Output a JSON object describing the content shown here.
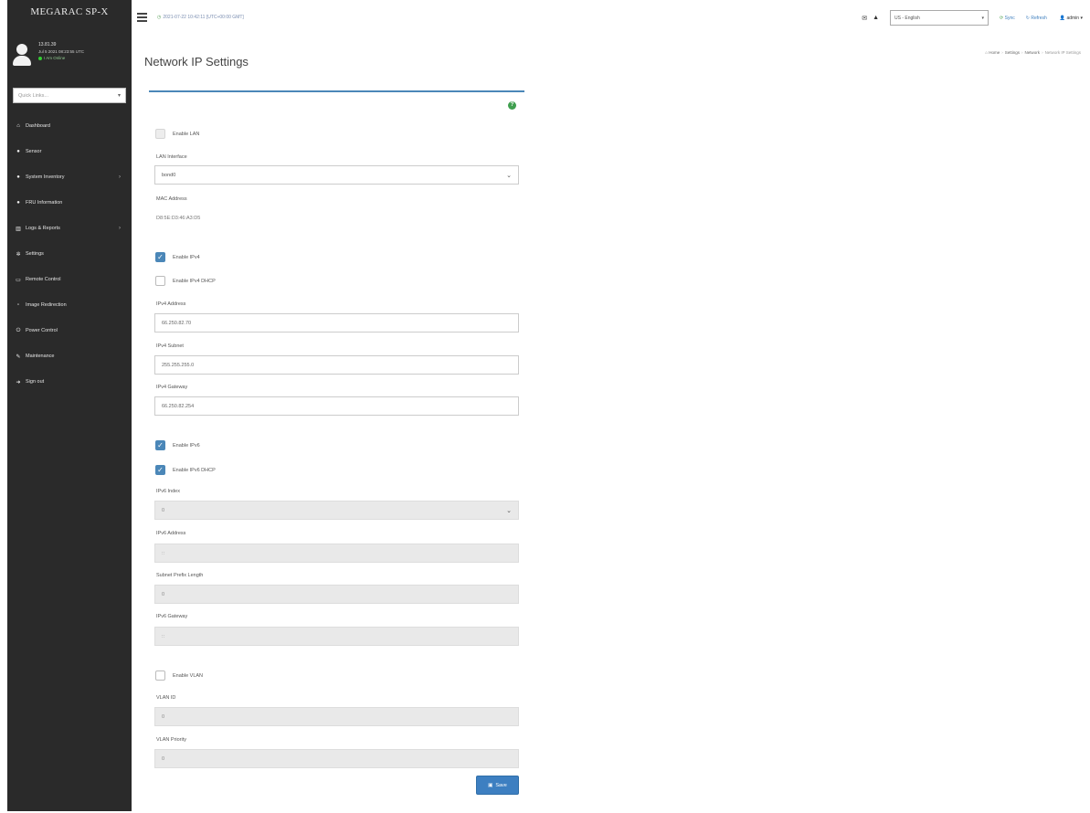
{
  "app": {
    "brand": "MEGARAC SP-X"
  },
  "user": {
    "name": "13.81.39",
    "session": "Jul 5 2021 08:23:55 UTC",
    "status": "I Am Online"
  },
  "sidebar": {
    "quicklinks_placeholder": "Quick Links...",
    "items": [
      {
        "label": "Dashboard",
        "icon": "home-icon"
      },
      {
        "label": "Sensor",
        "icon": "sensor-icon"
      },
      {
        "label": "System Inventory",
        "icon": "inventory-icon"
      },
      {
        "label": "FRU Information",
        "icon": "fru-icon"
      },
      {
        "label": "Logs & Reports",
        "icon": "chart-icon"
      },
      {
        "label": "Settings",
        "icon": "gear-icon"
      },
      {
        "label": "Remote Control",
        "icon": "monitor-icon"
      },
      {
        "label": "Image Redirection",
        "icon": "image-icon"
      },
      {
        "label": "Power Control",
        "icon": "power-icon"
      },
      {
        "label": "Maintenance",
        "icon": "wrench-icon"
      },
      {
        "label": "Sign out",
        "icon": "signout-icon"
      }
    ]
  },
  "topbar": {
    "datetime": "2021-07-22 10:42:11 [UTC+00:00 GMT]",
    "language": "US - English",
    "sync": "Sync",
    "refresh": "Refresh",
    "user": "admin"
  },
  "breadcrumb": [
    "Home",
    "Settings",
    "Network",
    "Network IP Settings"
  ],
  "page": {
    "title": "Network IP Settings"
  },
  "form": {
    "enable_lan": {
      "label": "Enable LAN",
      "checked": false
    },
    "lan_interface": {
      "label": "LAN Interface",
      "value": "bond0"
    },
    "mac_address": {
      "label": "MAC Address",
      "value": "D8:5E:D3:46:A3:D5"
    },
    "enable_ipv4": {
      "label": "Enable IPv4",
      "checked": true
    },
    "enable_ipv4_dhcp": {
      "label": "Enable IPv4 DHCP",
      "checked": false
    },
    "ipv4_address": {
      "label": "IPv4 Address",
      "value": "66.250.82.70"
    },
    "ipv4_subnet": {
      "label": "IPv4 Subnet",
      "value": "255.255.255.0"
    },
    "ipv4_gateway": {
      "label": "IPv4 Gateway",
      "value": "66.250.82.254"
    },
    "enable_ipv6": {
      "label": "Enable IPv6",
      "checked": true
    },
    "enable_ipv6_dhcp": {
      "label": "Enable IPv6 DHCP",
      "checked": true
    },
    "ipv6_index": {
      "label": "IPv6 Index",
      "value": "0"
    },
    "ipv6_address": {
      "label": "IPv6 Address",
      "value": "::"
    },
    "subnet_prefix": {
      "label": "Subnet Prefix Length",
      "value": "0"
    },
    "ipv6_gateway": {
      "label": "IPv6 Gateway",
      "value": "::"
    },
    "enable_vlan": {
      "label": "Enable VLAN",
      "checked": false
    },
    "vlan_id": {
      "label": "VLAN ID",
      "value": "0"
    },
    "vlan_priority": {
      "label": "VLAN Priority",
      "value": "0"
    },
    "save_label": "Save"
  },
  "colors": {
    "sidebar_bg": "#2a2a2a",
    "accent": "#4b87b8",
    "save_button": "#3d7fc1",
    "online": "#33cc33"
  }
}
